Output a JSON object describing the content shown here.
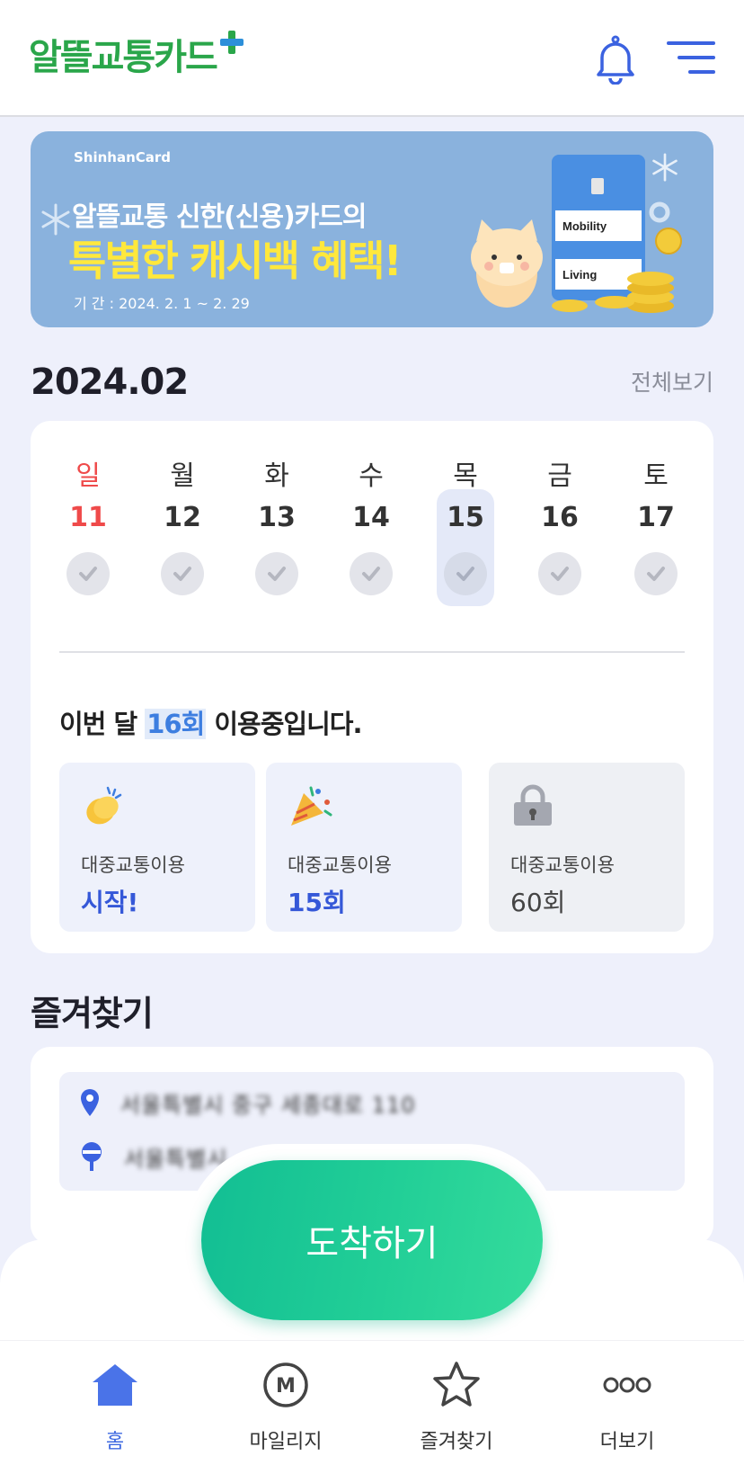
{
  "header": {
    "logo_main": "알뜰교통카드",
    "logo_plus": "+",
    "icons": [
      "bell-icon",
      "menu-icon"
    ]
  },
  "banner": {
    "brand": "ShinhanCard",
    "line1": "알뜰교통 신한(신용)카드의",
    "line2": "특별한 캐시백 혜택!",
    "period": "기 간 : 2024. 2. 1 ~ 2. 29",
    "card_label_1": "Mobility",
    "card_label_2": "Living"
  },
  "calendar": {
    "month": "2024.02",
    "view_all": "전체보기",
    "days": [
      {
        "name": "일",
        "num": "11"
      },
      {
        "name": "월",
        "num": "12"
      },
      {
        "name": "화",
        "num": "13"
      },
      {
        "name": "수",
        "num": "14"
      },
      {
        "name": "목",
        "num": "15"
      },
      {
        "name": "금",
        "num": "16"
      },
      {
        "name": "토",
        "num": "17"
      }
    ],
    "today_index": 4,
    "usage_prefix": "이번 달 ",
    "usage_count": "16회",
    "usage_suffix": " 이용중입니다.",
    "badges": [
      {
        "icon": "clapping-hands-icon",
        "label": "대중교통이용",
        "value": "시작!",
        "locked": false
      },
      {
        "icon": "party-popper-icon",
        "label": "대중교통이용",
        "value": "15회",
        "locked": false
      },
      {
        "icon": "lock-icon",
        "label": "대중교통이용",
        "value": "60회",
        "locked": true
      }
    ]
  },
  "favorites": {
    "title": "즐겨찾기",
    "rows": [
      {
        "icon": "location-pin-icon",
        "text": "서울특별시 중구 세종대로 110"
      },
      {
        "icon": "destination-pin-icon",
        "text": "서울특별시"
      }
    ]
  },
  "arrive_button": "도착하기",
  "tabs": [
    {
      "label": "홈",
      "icon": "home-icon",
      "active": true
    },
    {
      "label": "마일리지",
      "icon": "mileage-icon",
      "active": false
    },
    {
      "label": "즐겨찾기",
      "icon": "star-icon",
      "active": false
    },
    {
      "label": "더보기",
      "icon": "more-icon",
      "active": false
    }
  ],
  "colors": {
    "accent": "#3d68e0",
    "sunday": "#ef4a4a",
    "arrive": "#22cf97",
    "banner_bg": "#8ab2dd"
  }
}
